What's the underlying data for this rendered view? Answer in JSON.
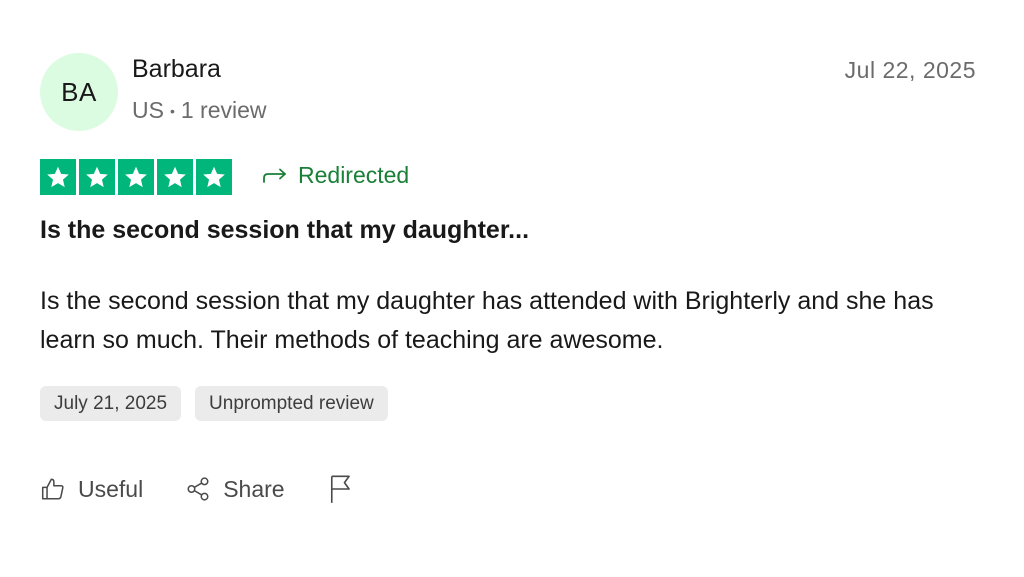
{
  "reviewer": {
    "initials": "BA",
    "name": "Barbara",
    "country": "US",
    "review_count": "1 review",
    "avatar_color": "#dcfce2"
  },
  "review": {
    "date": "Jul 22, 2025",
    "rating": 5,
    "star_color": "#00b67a",
    "redirected_label": "Redirected",
    "title": "Is the second session that my daughter...",
    "body": "Is the second session that my daughter has attended with Brighterly and she has learn so much. Their methods of teaching are awesome.",
    "tags": [
      "July 21, 2025",
      "Unprompted review"
    ]
  },
  "actions": {
    "useful_label": "Useful",
    "share_label": "Share"
  },
  "icons": [
    "thumbs-up-icon",
    "share-icon",
    "flag-icon",
    "redirect-arrow-icon",
    "star-icon"
  ]
}
